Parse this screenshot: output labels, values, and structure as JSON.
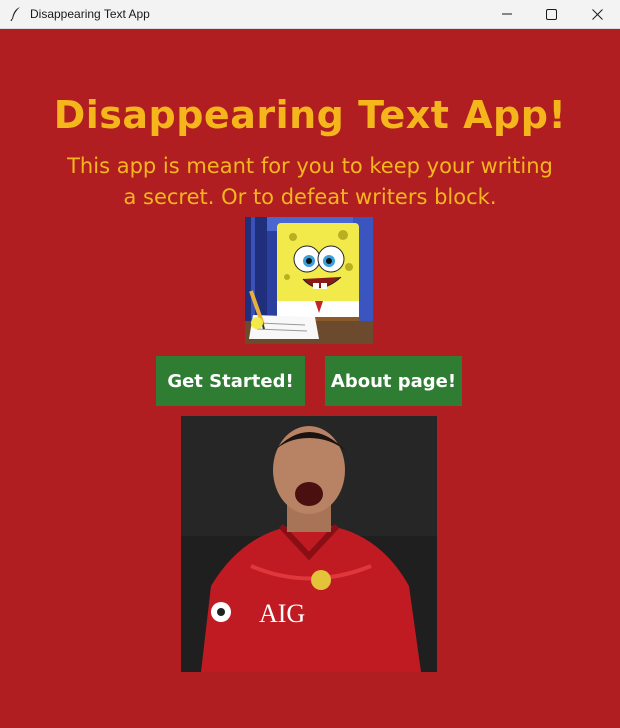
{
  "window": {
    "title": "Disappearing Text App",
    "app_icon": "feather-icon",
    "controls": [
      "minimize-icon",
      "maximize-icon",
      "close-icon"
    ]
  },
  "main": {
    "heading": "Disappearing Text App!",
    "subtitle_line1": "This app is meant for you to keep your writing",
    "subtitle_line2": "a secret. Or to defeat writers block."
  },
  "buttons": {
    "get_started": "Get Started!",
    "about": "About page!"
  },
  "colors": {
    "background": "#b01e22",
    "text_accent": "#f5b61c",
    "button_bg": "#2e7d32",
    "button_text": "#ffffff"
  }
}
